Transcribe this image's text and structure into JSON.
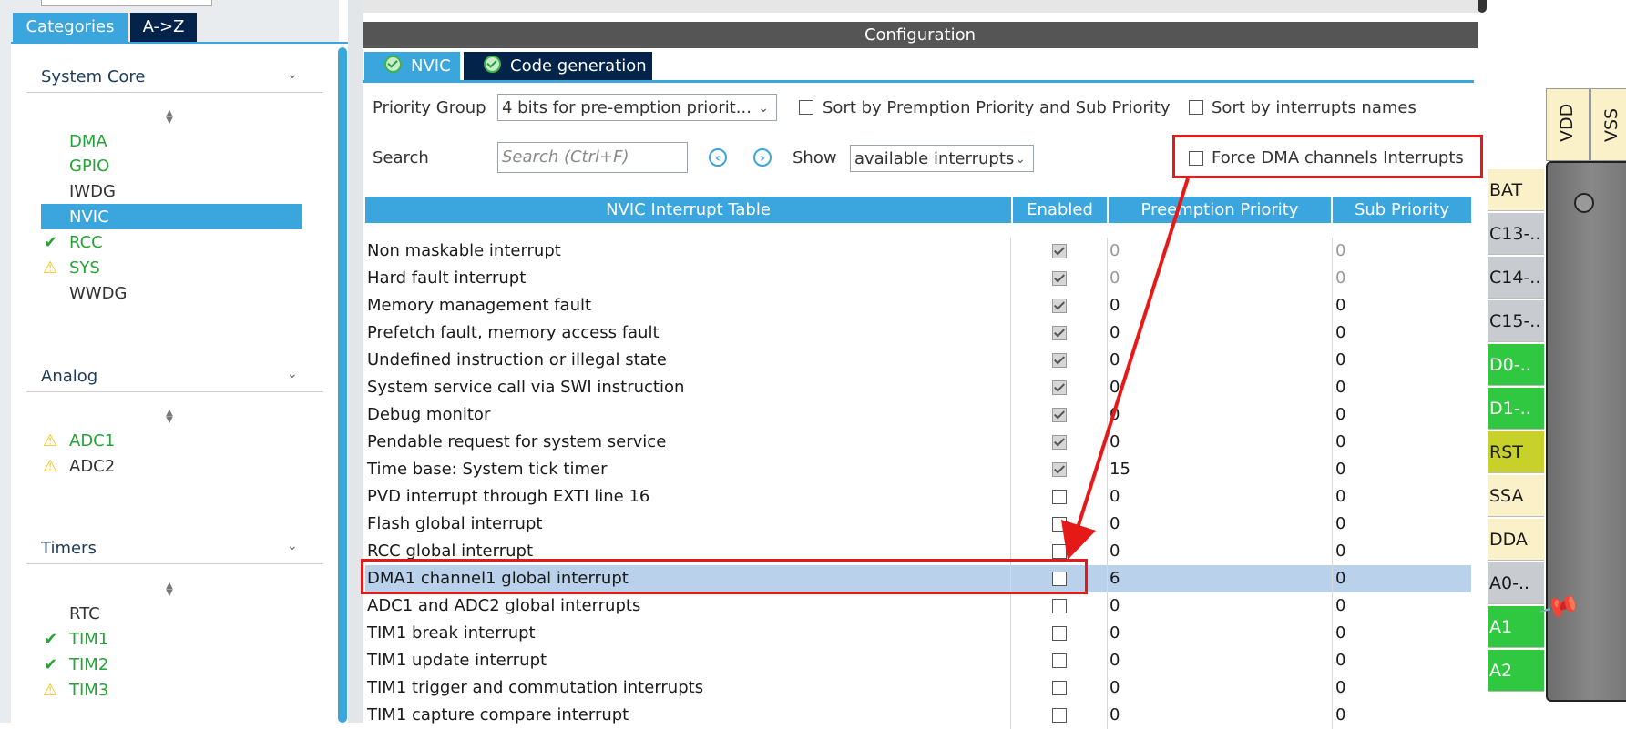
{
  "left_panel": {
    "tabs": [
      "Categories",
      "A->Z"
    ],
    "sections": [
      {
        "title": "System Core",
        "items": [
          {
            "label": "DMA",
            "status": "none",
            "color": "green"
          },
          {
            "label": "GPIO",
            "status": "none",
            "color": "green"
          },
          {
            "label": "IWDG",
            "status": "none",
            "color": "dark"
          },
          {
            "label": "NVIC",
            "status": "selected",
            "color": "white"
          },
          {
            "label": "RCC",
            "status": "check",
            "color": "green"
          },
          {
            "label": "SYS",
            "status": "warning",
            "color": "green"
          },
          {
            "label": "WWDG",
            "status": "none",
            "color": "dark"
          }
        ]
      },
      {
        "title": "Analog",
        "items": [
          {
            "label": "ADC1",
            "status": "warning",
            "color": "green"
          },
          {
            "label": "ADC2",
            "status": "warning",
            "color": "dark"
          }
        ]
      },
      {
        "title": "Timers",
        "items": [
          {
            "label": "RTC",
            "status": "none",
            "color": "dark"
          },
          {
            "label": "TIM1",
            "status": "check",
            "color": "green"
          },
          {
            "label": "TIM2",
            "status": "check",
            "color": "green"
          },
          {
            "label": "TIM3",
            "status": "warning",
            "color": "green"
          }
        ]
      }
    ]
  },
  "config": {
    "title": "Configuration",
    "tabs": [
      "NVIC",
      "Code generation"
    ],
    "priority_group_label": "Priority Group",
    "priority_group_value": "4 bits for pre-emption priorit...",
    "sort_premption_label": "Sort by Premption Priority and Sub Priority",
    "sort_names_label": "Sort by interrupts names",
    "search_label": "Search",
    "search_placeholder": "Search (Ctrl+F)",
    "show_label": "Show",
    "show_value": "available interrupts",
    "force_dma_label": "Force DMA channels Interrupts",
    "table_headers": [
      "NVIC Interrupt Table",
      "Enabled",
      "Preemption Priority",
      "Sub Priority"
    ],
    "rows": [
      {
        "name": "Non maskable interrupt",
        "enabled": true,
        "locked": true,
        "preemption": "0",
        "sub": "0"
      },
      {
        "name": "Hard fault interrupt",
        "enabled": true,
        "locked": true,
        "preemption": "0",
        "sub": "0"
      },
      {
        "name": "Memory management fault",
        "enabled": true,
        "locked": false,
        "preemption": "0",
        "sub": "0"
      },
      {
        "name": "Prefetch fault, memory access fault",
        "enabled": true,
        "locked": false,
        "preemption": "0",
        "sub": "0"
      },
      {
        "name": "Undefined instruction or illegal state",
        "enabled": true,
        "locked": false,
        "preemption": "0",
        "sub": "0"
      },
      {
        "name": "System service call via SWI instruction",
        "enabled": true,
        "locked": false,
        "preemption": "0",
        "sub": "0"
      },
      {
        "name": "Debug monitor",
        "enabled": true,
        "locked": false,
        "preemption": "0",
        "sub": "0"
      },
      {
        "name": "Pendable request for system service",
        "enabled": true,
        "locked": false,
        "preemption": "0",
        "sub": "0"
      },
      {
        "name": "Time base: System tick timer",
        "enabled": true,
        "locked": false,
        "preemption": "15",
        "sub": "0"
      },
      {
        "name": "PVD interrupt through EXTI line 16",
        "enabled": false,
        "locked": false,
        "preemption": "0",
        "sub": "0"
      },
      {
        "name": "Flash global interrupt",
        "enabled": false,
        "locked": false,
        "preemption": "0",
        "sub": "0"
      },
      {
        "name": "RCC global interrupt",
        "enabled": false,
        "locked": false,
        "preemption": "0",
        "sub": "0"
      },
      {
        "name": "DMA1 channel1 global interrupt",
        "enabled": false,
        "locked": false,
        "preemption": "6",
        "sub": "0",
        "highlighted": true
      },
      {
        "name": "ADC1 and ADC2 global interrupts",
        "enabled": false,
        "locked": false,
        "preemption": "0",
        "sub": "0"
      },
      {
        "name": "TIM1 break interrupt",
        "enabled": false,
        "locked": false,
        "preemption": "0",
        "sub": "0"
      },
      {
        "name": "TIM1 update interrupt",
        "enabled": false,
        "locked": false,
        "preemption": "0",
        "sub": "0"
      },
      {
        "name": "TIM1 trigger and commutation interrupts",
        "enabled": false,
        "locked": false,
        "preemption": "0",
        "sub": "0"
      },
      {
        "name": "TIM1 capture compare interrupt",
        "enabled": false,
        "locked": false,
        "preemption": "0",
        "sub": "0"
      }
    ]
  },
  "chip": {
    "top_pins": [
      "VDD",
      "VSS"
    ],
    "side_pins": [
      {
        "label": "BAT",
        "color": "#fbf1c9"
      },
      {
        "label": "C13-..",
        "color": "#c8ccd1"
      },
      {
        "label": "C14-..",
        "color": "#c8ccd1"
      },
      {
        "label": "C15-..",
        "color": "#c8ccd1"
      },
      {
        "label": "D0-..",
        "color": "#2fc840",
        "text_color": "#ffffff"
      },
      {
        "label": "D1-..",
        "color": "#2fc840",
        "text_color": "#ffffff"
      },
      {
        "label": "RST",
        "color": "#c8d12a"
      },
      {
        "label": "SSA",
        "color": "#fbf1c9"
      },
      {
        "label": "DDA",
        "color": "#fbf1c9"
      },
      {
        "label": "A0-..",
        "color": "#c8ccd1"
      },
      {
        "label": "A1",
        "color": "#2fc840",
        "text_color": "#ffffff"
      },
      {
        "label": "A2",
        "color": "#2fc840",
        "text_color": "#ffffff"
      }
    ]
  },
  "colors": {
    "accent": "#3aa6dd",
    "dark_tab": "#03234b",
    "annotation": "#e61919",
    "highlight_row": "#b9d1ea"
  }
}
